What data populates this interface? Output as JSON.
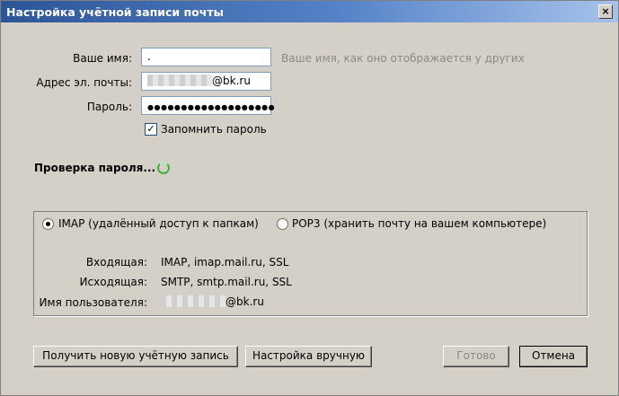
{
  "window": {
    "title": "Настройка учётной записи почты",
    "close_glyph": "×"
  },
  "form": {
    "name_label": "Ваше имя:",
    "name_value": ".",
    "name_hint": "Ваше имя, как оно отображается у других",
    "email_label": "Адрес эл. почты:",
    "email_suffix": "@bk.ru",
    "password_label": "Пароль:",
    "password_mask": "●●●●●●●●●●●●●●●●●●●",
    "remember_label": "Запомнить пароль",
    "remember_checked": true
  },
  "status": {
    "text": "Проверка пароля...",
    "spinner_color": "#3cb43c"
  },
  "server": {
    "imap_label": "IMAP (удалённый доступ к папкам)",
    "pop3_label": "POP3 (хранить почту на вашем компьютере)",
    "selected": "IMAP",
    "incoming_label": "Входящая:",
    "incoming_value": "IMAP, imap.mail.ru, SSL",
    "outgoing_label": "Исходящая:",
    "outgoing_value": "SMTP, smtp.mail.ru, SSL",
    "username_label": "Имя пользователя:",
    "username_suffix": "@bk.ru"
  },
  "buttons": {
    "get_new_account": "Получить новую учётную запись",
    "manual_config": "Настройка вручную",
    "done": "Готово",
    "cancel": "Отмена"
  },
  "colors": {
    "title_bar": "#2c5597",
    "window_bg": "#d4d0c8",
    "hint_text": "#8a8a8a"
  }
}
